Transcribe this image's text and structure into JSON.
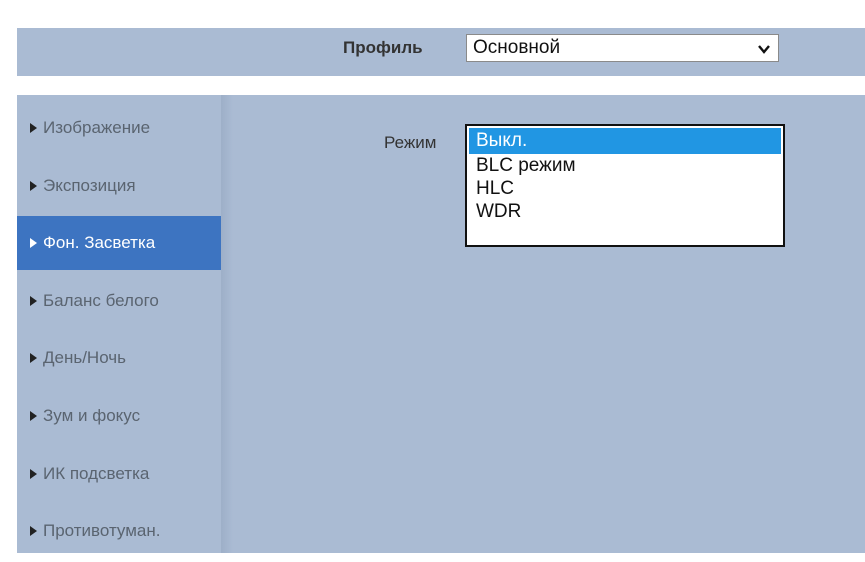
{
  "header": {
    "profile_label": "Профиль",
    "profile_value": "Основной"
  },
  "sidebar": {
    "items": [
      {
        "label": "Изображение"
      },
      {
        "label": "Экспозиция"
      },
      {
        "label": "Фон. Засветка"
      },
      {
        "label": "Баланс белого"
      },
      {
        "label": "День/Ночь"
      },
      {
        "label": "Зум и фокус"
      },
      {
        "label": "ИК подсветка"
      },
      {
        "label": "Противотуман."
      }
    ],
    "active_index": 2
  },
  "main": {
    "mode_label": "Режим",
    "mode_options": [
      {
        "label": "Выкл."
      },
      {
        "label": "BLC режим"
      },
      {
        "label": "HLC"
      },
      {
        "label": "WDR"
      }
    ],
    "selected_index": 0
  },
  "colors": {
    "panel_bg": "#aabbd3",
    "active_item_bg": "#3d74c1",
    "selected_option_bg": "#2196e3"
  },
  "icons": {
    "menu_bullet": "triangle-right-icon",
    "dropdown": "chevron-down-icon"
  }
}
